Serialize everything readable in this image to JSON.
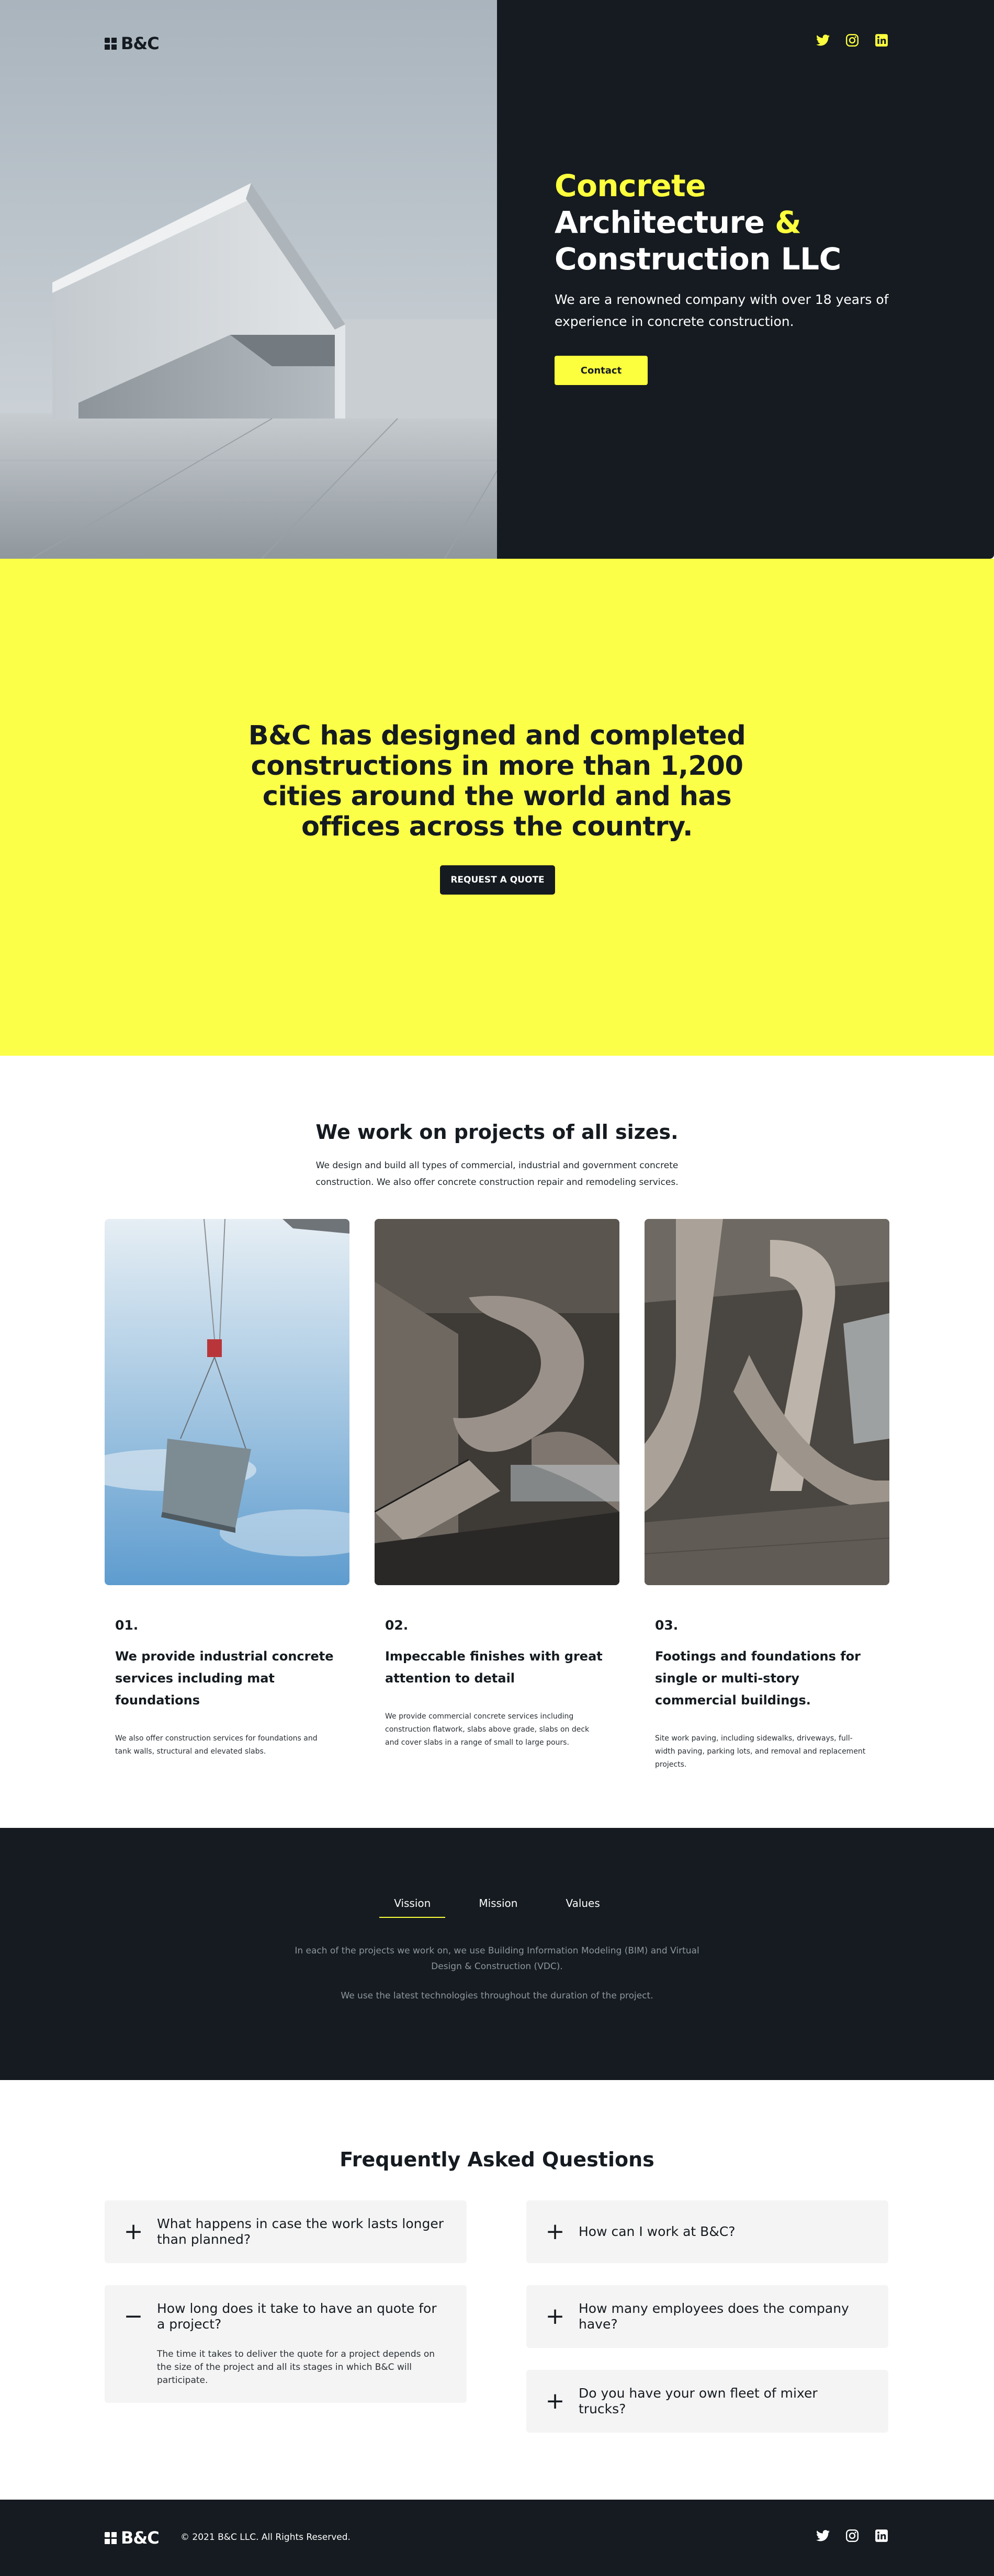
{
  "brand": {
    "name": "B&C"
  },
  "hero": {
    "title_line1": "Concrete",
    "title_line2": "Architecture",
    "title_amp": "&",
    "title_line3": "Construction LLC",
    "subtitle": "We are a renowned company with over 18 years of experience in concrete construction.",
    "cta_label": "Contact"
  },
  "social": {
    "icons": [
      "twitter-icon",
      "instagram-icon",
      "linkedin-icon"
    ],
    "accent": "#fcff3d"
  },
  "banner": {
    "text": "B&C has designed and completed constructions in more than 1,200 cities around the world and has offices across the country.",
    "cta_label": "REQUEST A QUOTE"
  },
  "projects": {
    "title": "We work on projects of all sizes.",
    "subtitle": "We design and build all types of commercial, industrial and government concrete construction. We also offer concrete construction repair and remodeling services.",
    "cards": [
      {
        "num": "01.",
        "heading": "We provide industrial concrete services including mat foundations",
        "body": "We also offer construction services for foundations and tank walls, structural and elevated slabs."
      },
      {
        "num": "02.",
        "heading": "Impeccable finishes with great attention to detail",
        "body": "We provide commercial concrete services including construction flatwork, slabs above grade, slabs on deck and cover slabs in a range of small to large pours."
      },
      {
        "num": "03.",
        "heading": "Footings and foundations for single or multi-story commercial buildings.",
        "body": "Site work paving, including sidewalks, driveways, full-width paving, parking lots, and removal and replacement projects."
      }
    ]
  },
  "vmv": {
    "tabs": [
      "Vission",
      "Mission",
      "Values"
    ],
    "active_tab": "Vission",
    "paragraph1": "In each of the projects we work on, we use Building Information Modeling (BIM) and Virtual Design & Construction (VDC).",
    "paragraph2": "We use the latest technologies throughout the duration of the project."
  },
  "faq": {
    "title": "Frequently Asked Questions",
    "left": [
      {
        "icon": "+",
        "question": "What happens in case the work lasts longer than planned?",
        "expanded": false
      },
      {
        "icon": "−",
        "question": "How long does it take to have an quote for a project?",
        "expanded": true,
        "answer": "The time it takes to deliver the quote for a project depends on the size of the project and all its stages in which B&C will participate."
      }
    ],
    "right": [
      {
        "icon": "+",
        "question": "How can I work at B&C?",
        "expanded": false
      },
      {
        "icon": "+",
        "question": "How many employees does the company have?",
        "expanded": false
      },
      {
        "icon": "+",
        "question": "Do you have your own fleet of mixer trucks?",
        "expanded": false
      }
    ]
  },
  "footer": {
    "copyright": "© 2021 B&C LLC. All Rights Reserved."
  }
}
